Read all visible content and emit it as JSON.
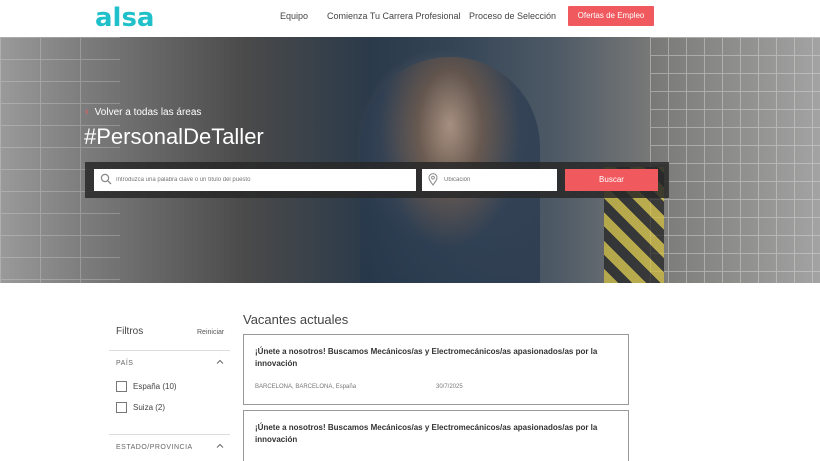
{
  "header": {
    "logo": "alsa",
    "nav": [
      "Equipo",
      "Comienza Tu Carrera Profesional",
      "Proceso de Selección"
    ],
    "cta_label": "Ofertas de Empleo"
  },
  "hero": {
    "back_label": "Volver a todas las áreas",
    "title": "#PersonalDeTaller",
    "search": {
      "keyword_placeholder": "Introduzca una palabra clave o un título del puesto",
      "location_placeholder": "Ubicación",
      "button_label": "Buscar"
    }
  },
  "filters": {
    "title": "Filtros",
    "reset_label": "Reiniciar",
    "sections": [
      {
        "label": "PAÍS",
        "options": [
          {
            "label": "España (10)",
            "checked": false
          },
          {
            "label": "Suiza (2)",
            "checked": false
          }
        ]
      },
      {
        "label": "ESTADO/PROVINCIA",
        "options": []
      }
    ]
  },
  "vacancies": {
    "title": "Vacantes actuales",
    "items": [
      {
        "title": "¡Únete a nosotros! Buscamos Mecánicos/as y Electromecánicos/as apasionados/as por la innovación",
        "location": "BARCELONA, BARCELONA, España",
        "date": "30/7/2025"
      },
      {
        "title": "¡Únete a nosotros! Buscamos Mecánicos/as y Electromecánicos/as apasionados/as por la innovación",
        "location": "",
        "date": ""
      }
    ]
  },
  "colors": {
    "brand_teal": "#1fc0c9",
    "accent_red": "#f0595e"
  },
  "icons": [
    "search-icon",
    "location-pin-icon",
    "chevron-left-icon",
    "chevron-up-icon"
  ]
}
